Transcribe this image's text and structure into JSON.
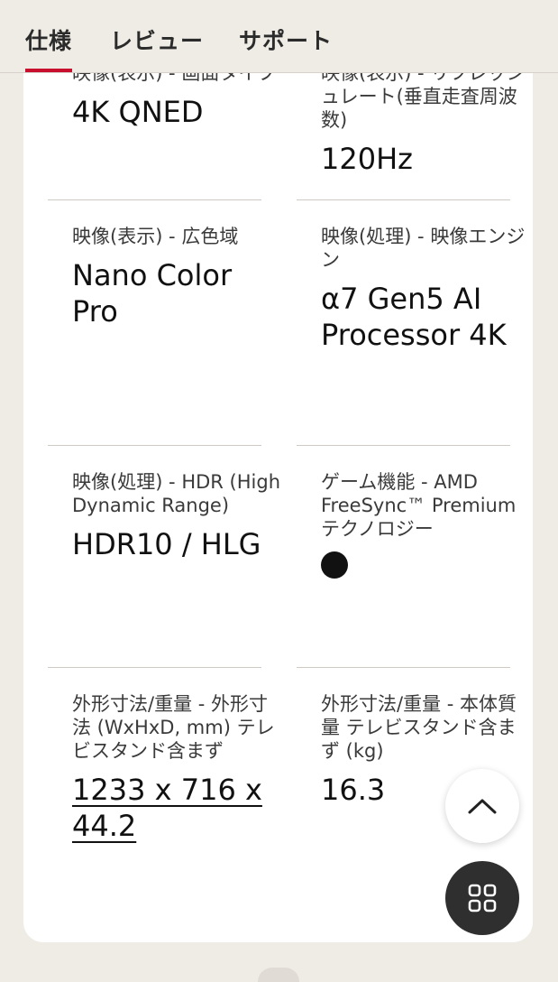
{
  "tabs": {
    "spec": "仕様",
    "review": "レビュー",
    "support": "サポート"
  },
  "specs": [
    {
      "label": "映像(表示) - 画面タイプ",
      "value": "4K QNED"
    },
    {
      "label": "映像(表示) - リフレッシュレート(垂直走査周波数)",
      "value": "120Hz"
    },
    {
      "label": "映像(表示) - 広色域",
      "value": "Nano Color Pro"
    },
    {
      "label": "映像(処理) - 映像エンジン",
      "value": "α7 Gen5 AI Processor 4K"
    },
    {
      "label": "映像(処理) - HDR (High Dynamic Range)",
      "value": "HDR10 / HLG"
    },
    {
      "label": "ゲーム機能 - AMD FreeSync™ Premiumテクノロジー",
      "value": "●"
    },
    {
      "label": "外形寸法/重量 - 外形寸法 (WxHxD, mm) テレビスタンド含まず",
      "value": "1233 x 716 x 44.2"
    },
    {
      "label": "外形寸法/重量 - 本体質量 テレビスタンド含まず (kg)",
      "value": "16.3"
    }
  ],
  "icons": {
    "scroll_top": "chevron-up-icon",
    "menu": "grid-menu-icon"
  },
  "colors": {
    "accent": "#c8102e",
    "background": "#efebe5",
    "card": "#ffffff",
    "menu_button": "#2f2f2f"
  }
}
